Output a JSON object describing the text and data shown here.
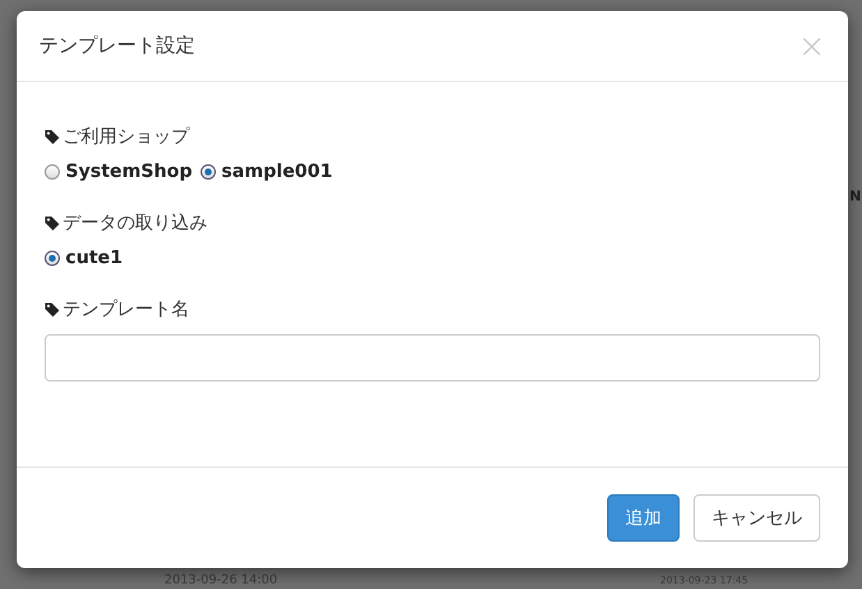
{
  "background": {
    "texts": [
      {
        "kind": "side",
        "text": "N"
      },
      {
        "kind": "date",
        "text": "2013-09-26 14:00"
      },
      {
        "kind": "date-small",
        "text": "2013-09-23 17:45"
      }
    ]
  },
  "dialog": {
    "title": "テンプレート設定",
    "close": "×",
    "sections": [
      {
        "kind": "radio",
        "label": "ご利用ショップ",
        "options": [
          {
            "label": "SystemShop",
            "selected": false
          },
          {
            "label": "sample001",
            "selected": true
          }
        ]
      },
      {
        "kind": "radio",
        "label": "データの取り込み",
        "options": [
          {
            "label": "cute1",
            "selected": true
          }
        ]
      },
      {
        "kind": "input",
        "label": "テンプレート名"
      }
    ],
    "buttons": [
      {
        "kind": "primary",
        "label": "追加"
      },
      {
        "kind": "default",
        "label": "キャンセル"
      }
    ]
  }
}
